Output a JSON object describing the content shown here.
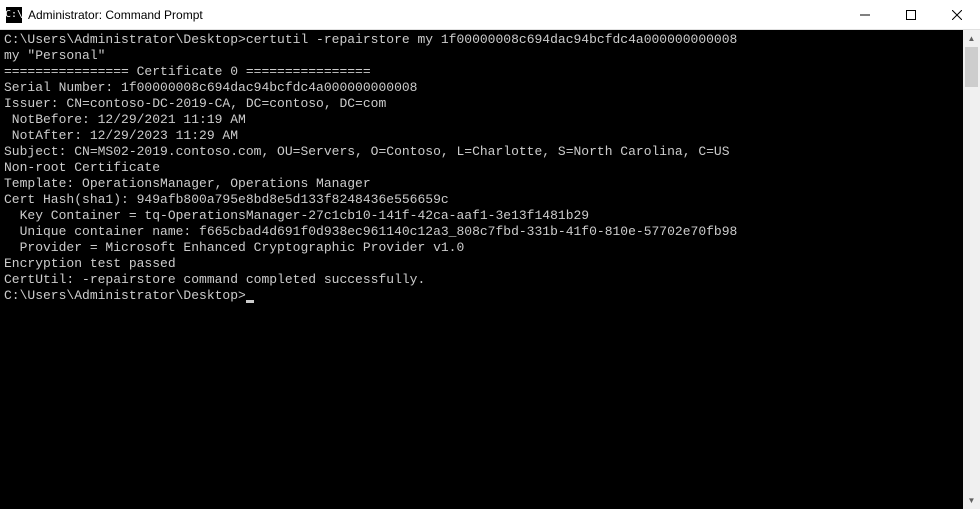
{
  "window": {
    "title": "Administrator: Command Prompt"
  },
  "terminal": {
    "prompt1": "C:\\Users\\Administrator\\Desktop>",
    "command1": "certutil -repairstore my 1f00000008c694dac94bcfdc4a000000000008",
    "lines": [
      "my \"Personal\"",
      "================ Certificate 0 ================",
      "Serial Number: 1f00000008c694dac94bcfdc4a000000000008",
      "Issuer: CN=contoso-DC-2019-CA, DC=contoso, DC=com",
      " NotBefore: 12/29/2021 11:19 AM",
      " NotAfter: 12/29/2023 11:29 AM",
      "Subject: CN=MS02-2019.contoso.com, OU=Servers, O=Contoso, L=Charlotte, S=North Carolina, C=US",
      "Non-root Certificate",
      "Template: OperationsManager, Operations Manager",
      "Cert Hash(sha1): 949afb800a795e8bd8e5d133f8248436e556659c",
      "  Key Container = tq-OperationsManager-27c1cb10-141f-42ca-aaf1-3e13f1481b29",
      "  Unique container name: f665cbad4d691f0d938ec961140c12a3_808c7fbd-331b-41f0-810e-57702e70fb98",
      "  Provider = Microsoft Enhanced Cryptographic Provider v1.0",
      "Encryption test passed",
      "CertUtil: -repairstore command completed successfully.",
      ""
    ],
    "prompt2": "C:\\Users\\Administrator\\Desktop>"
  }
}
